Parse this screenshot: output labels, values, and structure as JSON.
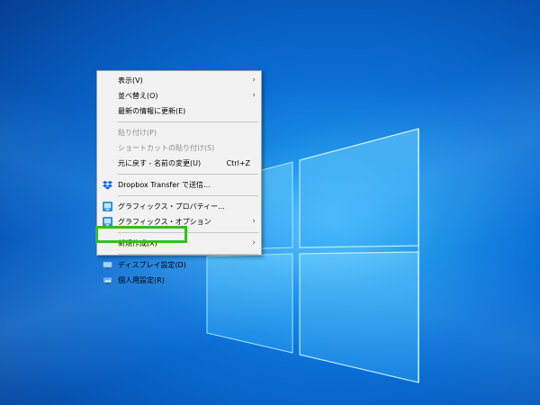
{
  "desktop": {
    "accent_color": "#0b6fd6"
  },
  "context_menu": {
    "items": [
      {
        "label": "表示(V)",
        "submenu": true
      },
      {
        "label": "並べ替え(O)",
        "submenu": true
      },
      {
        "label": "最新の情報に更新(E)"
      },
      {
        "label": "貼り付け(P)",
        "disabled": true
      },
      {
        "label": "ショートカットの貼り付け(S)",
        "disabled": true
      },
      {
        "label": "元に戻す - 名前の変更(U)",
        "shortcut": "Ctrl+Z"
      },
      {
        "label": "Dropbox Transfer で送信...",
        "icon": "dropbox-icon"
      },
      {
        "label": "グラフィックス・プロパティー...",
        "icon": "intel-graphics-icon"
      },
      {
        "label": "グラフィックス・オプション",
        "icon": "intel-graphics-icon",
        "submenu": true
      },
      {
        "label": "新規作成(X)",
        "submenu": true
      },
      {
        "label": "ディスプレイ設定(D)",
        "icon": "display-icon"
      },
      {
        "label": "個人用設定(R)",
        "icon": "personalize-icon"
      }
    ]
  },
  "highlight_color": "#2fc21a"
}
